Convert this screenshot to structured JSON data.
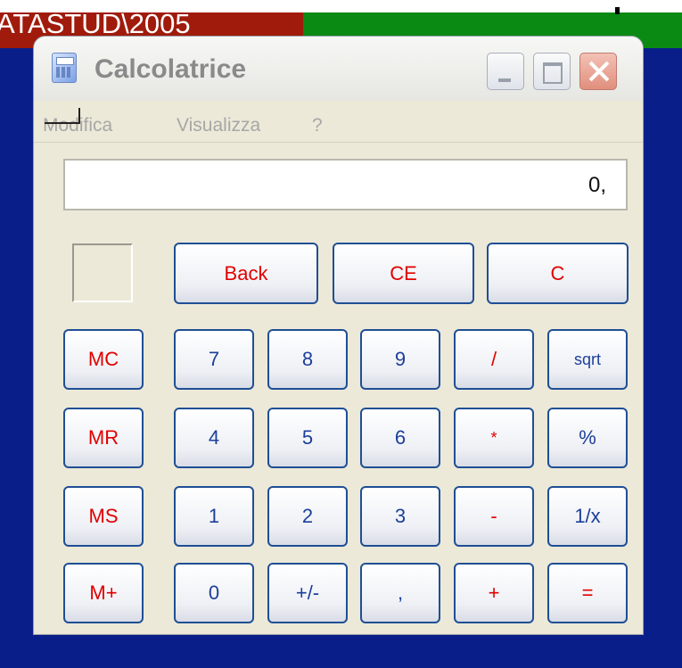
{
  "background": {
    "tab_text": "ATASTUD\\2005",
    "colors": {
      "desktop": "#0a1e8a",
      "tab_red": "#a01b0b",
      "tab_green": "#0a8a13"
    }
  },
  "window": {
    "title": "Calcolatrice",
    "icon": "calculator-icon",
    "controls": {
      "minimize": "minimize-icon",
      "maximize": "maximize-icon",
      "close": "close-icon"
    }
  },
  "menu": {
    "items": [
      "Modifica",
      "Visualizza",
      "?"
    ]
  },
  "display": {
    "value": "0,"
  },
  "buttons": {
    "back": "Back",
    "ce": "CE",
    "c": "C",
    "mc": "MC",
    "mr": "MR",
    "ms": "MS",
    "mplus": "M+",
    "n7": "7",
    "n8": "8",
    "n9": "9",
    "div": "/",
    "sqrt": "sqrt",
    "n4": "4",
    "n5": "5",
    "n6": "6",
    "mul": "*",
    "pct": "%",
    "n1": "1",
    "n2": "2",
    "n3": "3",
    "sub": "-",
    "inv": "1/x",
    "n0": "0",
    "neg": "+/-",
    "dec": ",",
    "add": "+",
    "eq": "="
  },
  "colors": {
    "key_blue": "#1c3f9a",
    "key_red": "#e10000",
    "window_bg": "#ece9d8"
  }
}
